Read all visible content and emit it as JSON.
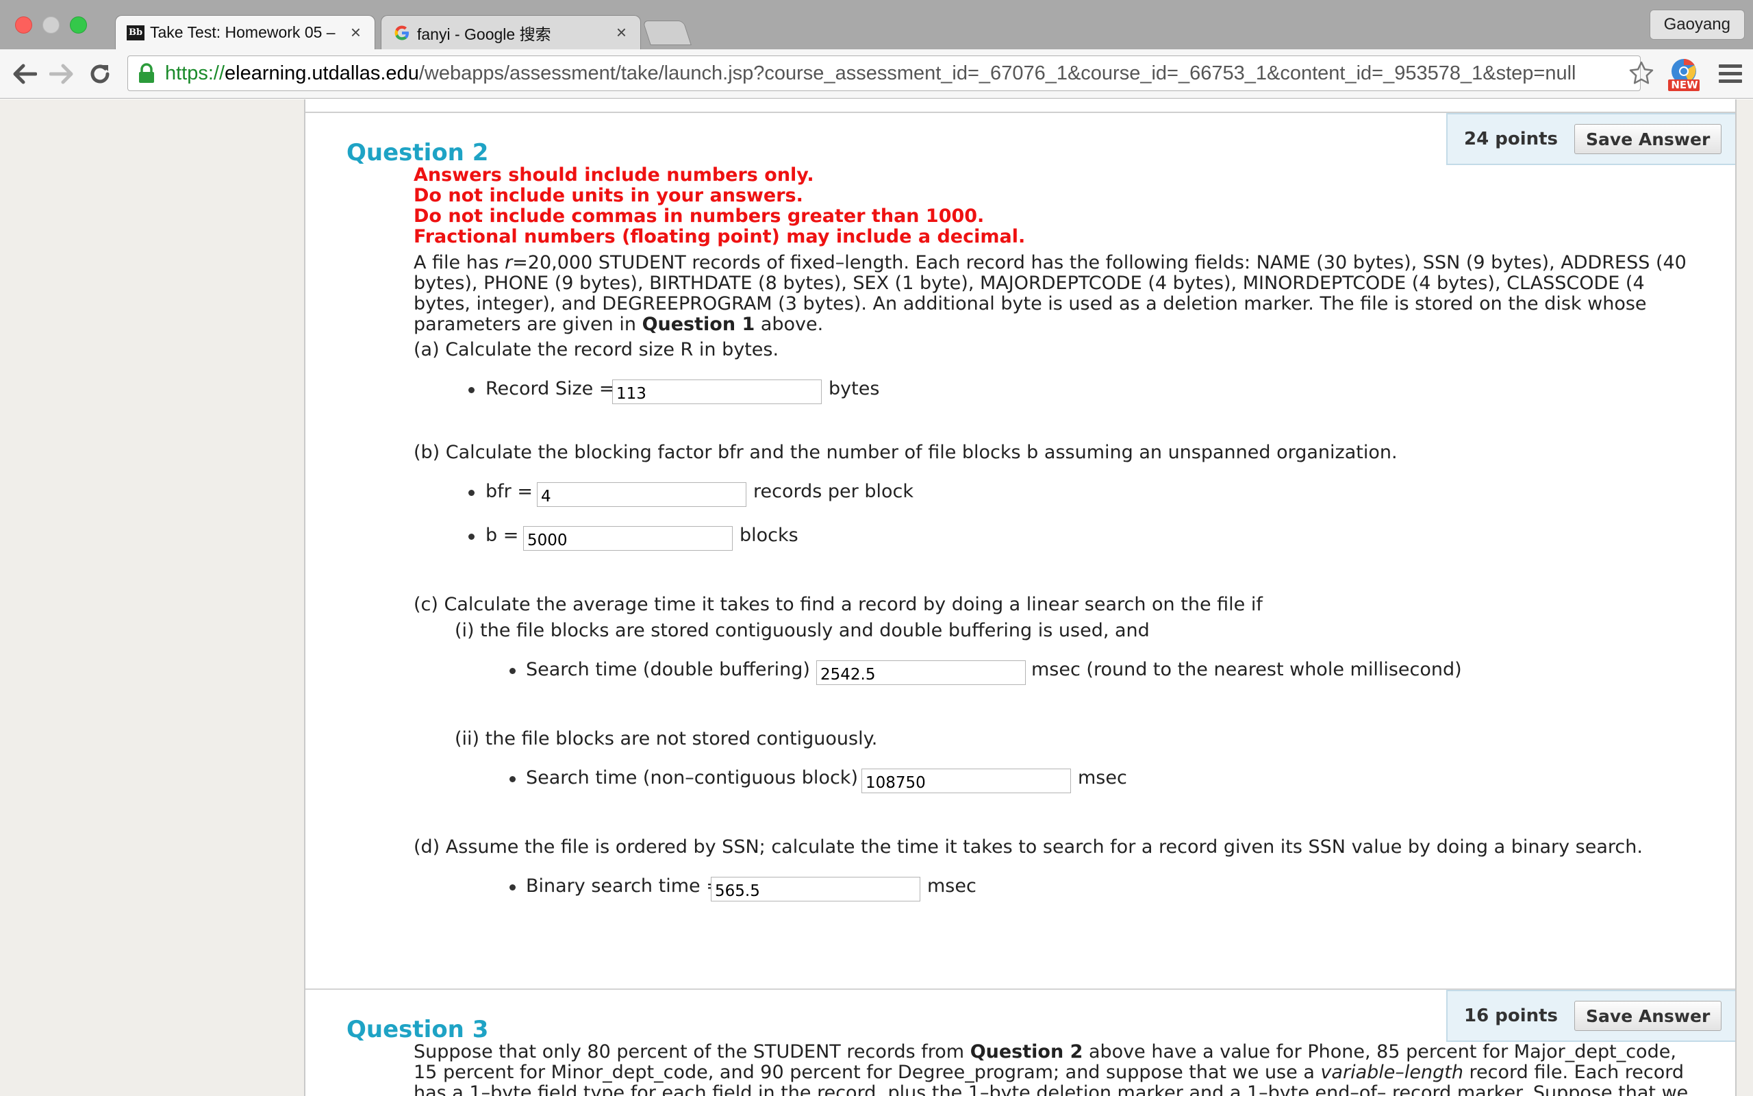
{
  "browser": {
    "tabs": [
      {
        "title": "Take Test: Homework 05 –",
        "favicon": "blackboard-icon",
        "active": true
      },
      {
        "title": "fanyi - Google 搜索",
        "favicon": "google-icon",
        "active": false
      }
    ],
    "profile_name": "Gaoyang",
    "url": {
      "scheme": "https://",
      "host": "elearning.utdallas.edu",
      "path": "/webapps/assessment/take/launch.jsp?course_assessment_id=_67076_1&course_id=_66753_1&content_id=_953578_1&step=null"
    },
    "extension_badge": "NEW"
  },
  "question2": {
    "title": "Question 2",
    "points": "24 points",
    "save_label": "Save Answer",
    "instructions": [
      "Answers should include numbers only.",
      "Do not include units in your answers.",
      "Do not include commas in numbers greater than 1000.",
      "Fractional numbers (floating point) may include a decimal."
    ],
    "description_html": "A file has <i>r</i>=20,000 STUDENT records of fixed–length. Each record has the following fields: NAME (30 bytes), SSN (9 bytes), ADDRESS (40 bytes), PHONE (9 bytes), BIRTHDATE (8 bytes), SEX (1 byte), MAJORDEPTCODE (4 bytes), MINORDEPTCODE (4 bytes), CLASSCODE (4 bytes, integer), and DEGREEPROGRAM (3 bytes). An additional byte is used as a deletion marker. The file is stored on the disk whose parameters are given in <b>Question 1</b> above.",
    "part_a": {
      "prompt": "(a) Calculate the record size R in bytes.",
      "label": "Record Size =",
      "value": "113",
      "unit": "bytes"
    },
    "part_b": {
      "prompt": "(b) Calculate the blocking factor bfr and the number of file blocks b assuming an unspanned organization.",
      "bfr_label": "bfr =",
      "bfr_value": "4",
      "bfr_unit": "records per block",
      "b_label": "b =",
      "b_value": "5000",
      "b_unit": "blocks"
    },
    "part_c": {
      "prompt": "(c) Calculate the average time it takes to find a record by doing a linear search on the file if",
      "sub_i": "(i) the file blocks are stored contiguously and double buffering is used, and",
      "i_label": "Search time (double buffering) =",
      "i_value": "2542.5",
      "i_unit": "msec (round to the nearest whole millisecond)",
      "sub_ii": "(ii) the file blocks are not stored contiguously.",
      "ii_label": "Search time (non–contiguous block) =",
      "ii_value": "108750",
      "ii_unit": "msec"
    },
    "part_d": {
      "prompt": "(d) Assume the file is ordered by SSN; calculate the time it takes to search for a record given its SSN value by doing a binary search.",
      "label": "Binary search time =",
      "value": "565.5",
      "unit": "msec"
    }
  },
  "question3": {
    "title": "Question 3",
    "points": "16 points",
    "save_label": "Save Answer",
    "description_html": "Suppose that only 80 percent of the STUDENT records from <b>Question 2</b> above have a value for Phone, 85 percent for Major_dept_code, 15 percent for Minor_dept_code, and 90 percent for Degree_program; and suppose that we use a <i>variable–length</i> record file. Each record has a 1–byte field type for each field in the record, plus the 1–byte deletion marker and a 1–byte end–of– record marker. Suppose that we use a spanned record"
  },
  "colors": {
    "accent_title": "#1ea3c5",
    "warning_red": "#ee1111",
    "points_bg": "#e7f2f8",
    "page_bg": "#f0eeea"
  }
}
